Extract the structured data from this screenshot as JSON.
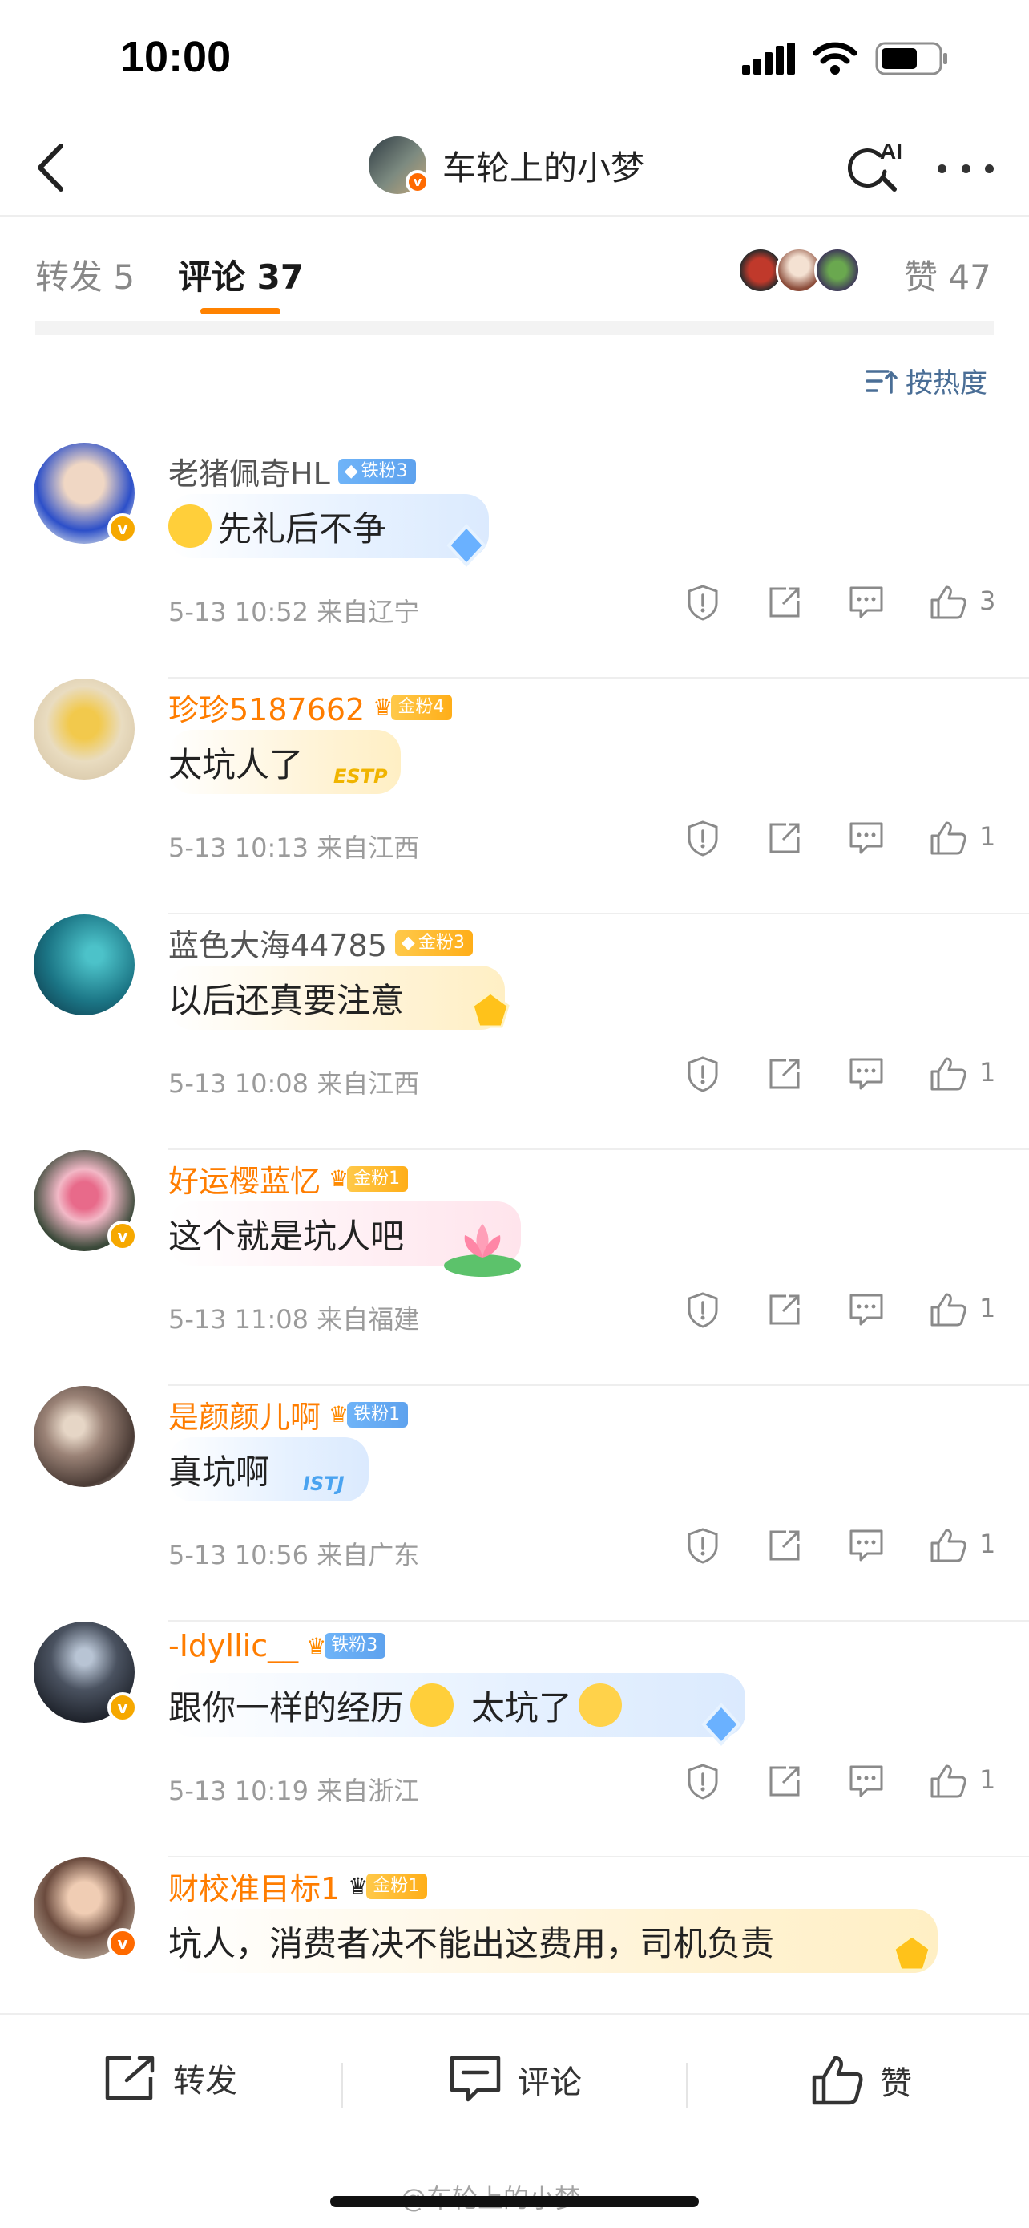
{
  "status_bar": {
    "time": "10:00"
  },
  "nav": {
    "title": "车轮上的小梦",
    "ai_label": "AI"
  },
  "tabs": {
    "repost": "转发 5",
    "comment": "评论 37",
    "like": "赞 47"
  },
  "sort": {
    "label": "按热度"
  },
  "comments": [
    {
      "username": "老猪佩奇HL",
      "fan_badge": "铁粉3",
      "fan_type": "iron",
      "text": "先礼后不争",
      "meta": "5-13 10:52  来自辽宁",
      "likes": "3",
      "avatar_color": "#3a5bd1"
    },
    {
      "username": "珍珍5187662",
      "fan_badge": "金粉4",
      "fan_type": "gold",
      "text": "太坑人了",
      "meta": "5-13 10:13  来自江西",
      "likes": "1",
      "bubble_tag": "ESTP",
      "avatar_color": "#e8d9b0"
    },
    {
      "username": "蓝色大海44785",
      "fan_badge": "金粉3",
      "fan_type": "gold",
      "text": "以后还真要注意",
      "meta": "5-13 10:08  来自江西",
      "likes": "1",
      "avatar_color": "#2a8a99"
    },
    {
      "username": "好运樱蓝忆",
      "fan_badge": "金粉1",
      "fan_type": "gold",
      "text": "这个就是坑人吧",
      "meta": "5-13 11:08  来自福建",
      "likes": "1",
      "avatar_color": "#c9a0a8"
    },
    {
      "username": "是颜颜儿啊",
      "fan_badge": "铁粉1",
      "fan_type": "iron",
      "text": "真坑啊",
      "meta": "5-13 10:56  来自广东",
      "likes": "1",
      "bubble_tag": "ISTJ",
      "avatar_color": "#6b5a52"
    },
    {
      "username": "-Idyllic__",
      "fan_badge": "铁粉3",
      "fan_type": "iron",
      "text_a": "跟你一样的经历",
      "text_b": "太坑了",
      "meta": "5-13 10:19  来自浙江",
      "likes": "1",
      "avatar_color": "#2c3038"
    },
    {
      "username": "财校准目标1",
      "fan_badge": "金粉1",
      "fan_type": "gold",
      "text": "坑人，消费者决不能出这费用，司机负责",
      "avatar_color": "#7a4a3a"
    }
  ],
  "bottom_bar": {
    "repost": "转发",
    "comment": "评论",
    "like": "赞"
  },
  "watermark": "@车轮上的小梦"
}
